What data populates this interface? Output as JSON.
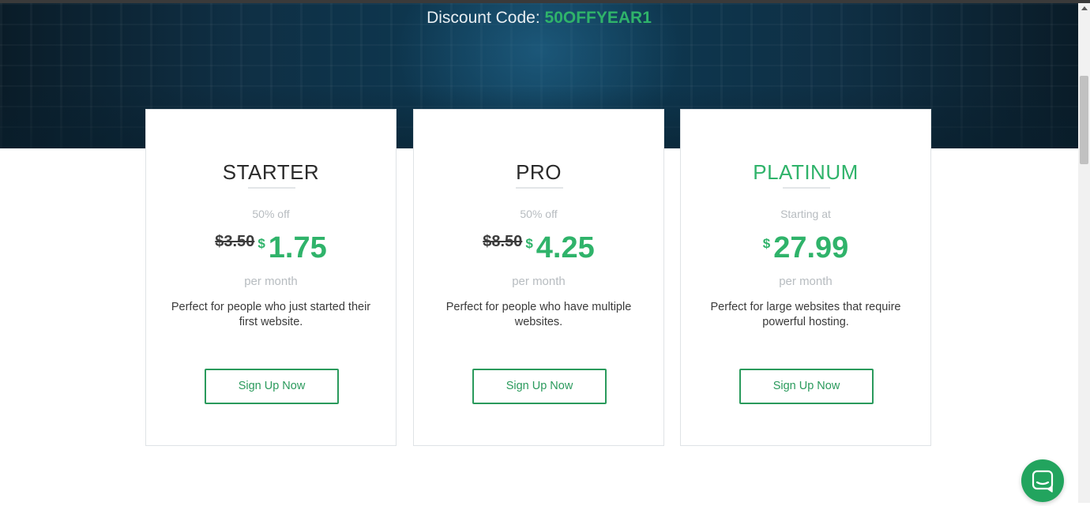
{
  "hero": {
    "discount_label": "Discount Code:",
    "discount_code": "50OFFYEAR1"
  },
  "plans": [
    {
      "name": "STARTER",
      "subtitle": "50% off",
      "old_price": "$3.50",
      "currency": "$",
      "price": "1.75",
      "period": "per month",
      "description": "Perfect for people who just started their first website.",
      "button": "Sign Up Now"
    },
    {
      "name": "PRO",
      "subtitle": "50% off",
      "old_price": "$8.50",
      "currency": "$",
      "price": "4.25",
      "period": "per month",
      "description": "Perfect for people who have multiple websites.",
      "button": "Sign Up Now"
    },
    {
      "name": "PLATINUM",
      "subtitle": "Starting at",
      "currency": "$",
      "price": "27.99",
      "period": "per month",
      "description": "Perfect for large websites that require powerful hosting.",
      "button": "Sign Up Now"
    }
  ],
  "colors": {
    "accent": "#2fb36a",
    "button_border": "#2a9a5c",
    "hero_bg": "#0d3b55"
  },
  "icons": {
    "chat": "chat-bubble-icon"
  }
}
